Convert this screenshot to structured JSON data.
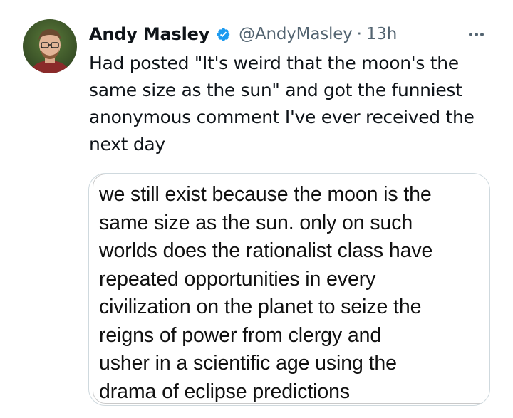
{
  "tweet": {
    "author_name": "Andy Masley",
    "handle": "@AndyMasley",
    "separator": "·",
    "timestamp": "13h",
    "text_lines": [
      "Had posted \"It's weird that the moon's the",
      "same size as the sun\" and got the funniest",
      "anonymous comment I've ever received the",
      "next day"
    ]
  },
  "media": {
    "comment_lines": [
      "we still exist because the moon is the",
      "same size as the sun. only on such",
      "worlds does the rationalist class have",
      "repeated opportunities in every",
      "civilization on the planet to seize the",
      "reigns of power from clergy and",
      "usher in a scientific age using the",
      "drama of eclipse predictions"
    ]
  },
  "icons": {
    "verified": "verified-badge-icon",
    "more": "more-options-icon"
  },
  "colors": {
    "text_primary": "#0f1419",
    "text_secondary": "#536471",
    "verified_blue": "#1d9bf0",
    "border": "#cfd9de"
  }
}
